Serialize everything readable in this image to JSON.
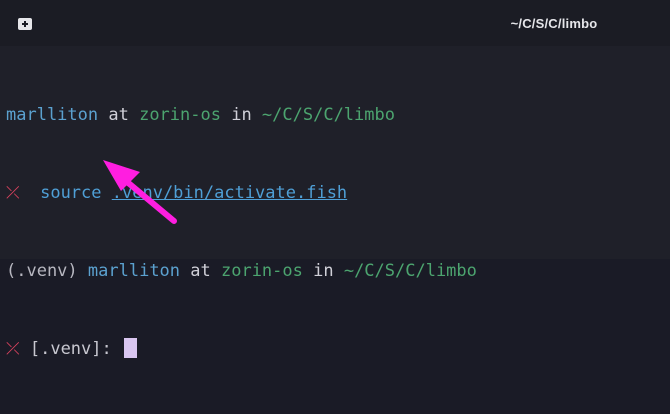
{
  "titlebar": {
    "title": "~/C/S/C/limbo",
    "new_tab_icon": "new-tab-icon"
  },
  "terminal": {
    "line1": {
      "user": "marlliton",
      "at": " at ",
      "host": "zorin-os",
      "in": " in ",
      "path": "~/C/S/C/limbo"
    },
    "line2": {
      "status_icon": "⤫",
      "command": "source",
      "argument": ".venv/bin/activate.fish"
    },
    "line3": {
      "venv": "(.venv)",
      "user": "marlliton",
      "at": " at ",
      "host": "zorin-os",
      "in": " in ",
      "path": "~/C/S/C/limbo"
    },
    "line4": {
      "status_icon": "⤫",
      "prompt": "[.venv]:"
    }
  },
  "colors": {
    "background": "#1f2029",
    "titlebar": "#1b1c24",
    "user": "#5ba1cf",
    "host": "#4ca46f",
    "error": "#d8425e",
    "cursor": "#d9c6f0",
    "arrow": "#ff1ee0"
  }
}
